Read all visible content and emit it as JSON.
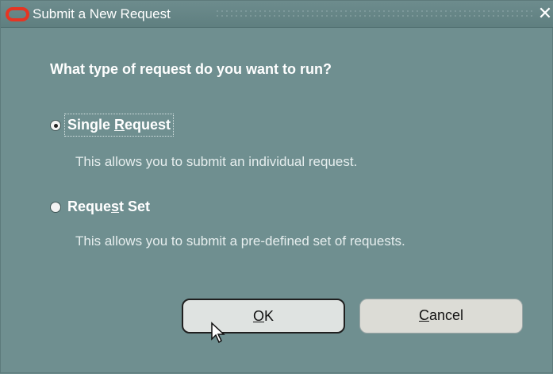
{
  "window": {
    "title": "Submit a New Request"
  },
  "dialog": {
    "question": "What type of request do you want to run?",
    "options": [
      {
        "label_pre": "Single ",
        "label_mnemonic": "R",
        "label_post": "equest",
        "description": "This allows you to submit an individual request.",
        "selected": true
      },
      {
        "label_pre": "Reque",
        "label_mnemonic": "s",
        "label_post": "t Set",
        "description": "This allows you to submit a pre-defined set of requests.",
        "selected": false
      }
    ]
  },
  "buttons": {
    "ok_mnemonic": "O",
    "ok_rest": "K",
    "cancel_mnemonic": "C",
    "cancel_rest": "ancel"
  },
  "icons": {
    "logo": "oracle-logo-icon",
    "close": "close-icon",
    "cursor": "mouse-pointer-icon"
  },
  "colors": {
    "background": "#6f8f90",
    "logo": "#e53523",
    "text": "#ffffff"
  }
}
